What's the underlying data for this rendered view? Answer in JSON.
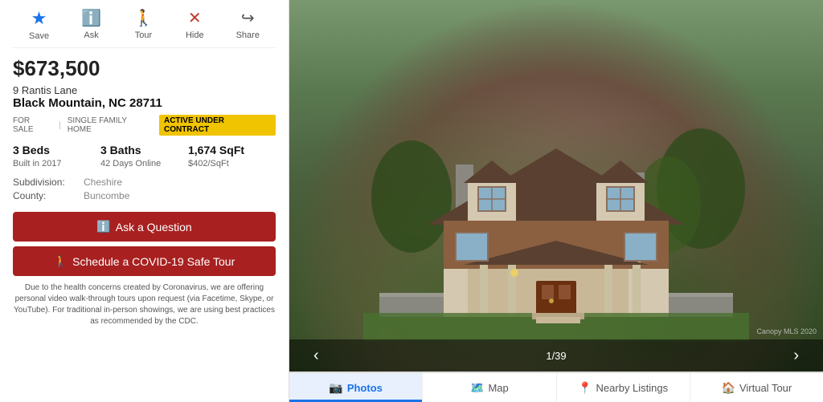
{
  "nav": {
    "save": {
      "label": "Save",
      "icon": "★"
    },
    "ask": {
      "label": "Ask",
      "icon": "ℹ"
    },
    "tour": {
      "label": "Tour",
      "icon": "🚶"
    },
    "hide": {
      "label": "Hide",
      "icon": "✕"
    },
    "share": {
      "label": "Share",
      "icon": "↪"
    }
  },
  "listing": {
    "price": "$673,500",
    "address_line1": "9 Rantis Lane",
    "address_line2": "Black Mountain, NC 28711",
    "tag_for_sale": "FOR SALE",
    "tag_type": "SINGLE FAMILY HOME",
    "tag_status": "ACTIVE UNDER CONTRACT",
    "beds": "3 Beds",
    "baths": "3 Baths",
    "sqft": "1,674 SqFt",
    "built": "Built in 2017",
    "days_online": "42 Days Online",
    "price_per_sqft": "$402/SqFt",
    "subdivision_label": "Subdivision:",
    "subdivision_value": "Cheshire",
    "county_label": "County:",
    "county_value": "Buncombe"
  },
  "buttons": {
    "ask_question": "Ask a Question",
    "schedule_tour": "Schedule a COVID-19 Safe Tour"
  },
  "covid_note": "Due to the health concerns created by Coronavirus, we are offering personal video walk-through tours upon request (via Facetime, Skype, or YouTube). For traditional in-person showings, we are using best practices as recommended by the CDC.",
  "photo": {
    "counter": "1/39",
    "prev": "‹",
    "next": "›",
    "watermark": "Canopy MLS 2020"
  },
  "tabs": [
    {
      "id": "photos",
      "label": "Photos",
      "icon": "📷",
      "active": true
    },
    {
      "id": "map",
      "label": "Map",
      "icon": "🗺",
      "active": false
    },
    {
      "id": "nearby",
      "label": "Nearby Listings",
      "icon": "📍",
      "active": false
    },
    {
      "id": "virtual",
      "label": "Virtual Tour",
      "icon": "🏠",
      "active": false
    }
  ]
}
